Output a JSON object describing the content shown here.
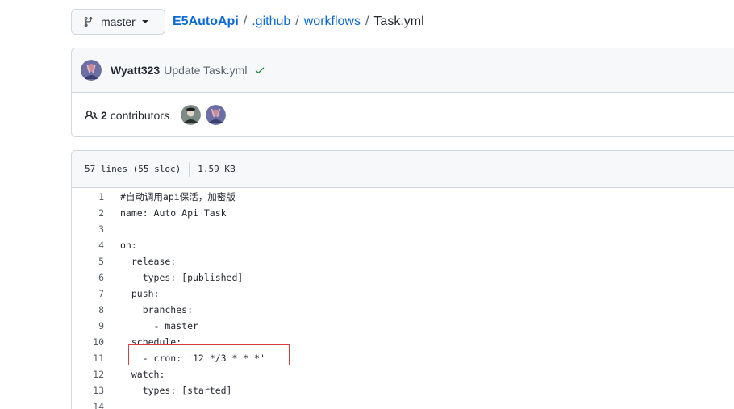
{
  "branch": {
    "label": "master"
  },
  "breadcrumb": {
    "repo": "E5AutoApi",
    "sep": "/",
    "folder1": ".github",
    "folder2": "workflows",
    "file": "Task.yml"
  },
  "commit": {
    "author": "Wyatt323",
    "message": "Update Task.yml"
  },
  "contributors": {
    "count": "2",
    "label": "contributors"
  },
  "file_info": {
    "lines": "57 lines (55 sloc)",
    "size": "1.59 KB"
  },
  "code_lines": [
    {
      "n": "1",
      "t": "#自动调用api保活，加密版"
    },
    {
      "n": "2",
      "t": "name: Auto Api Task"
    },
    {
      "n": "3",
      "t": ""
    },
    {
      "n": "4",
      "t": "on:"
    },
    {
      "n": "5",
      "t": "  release:"
    },
    {
      "n": "6",
      "t": "    types: [published]"
    },
    {
      "n": "7",
      "t": "  push:"
    },
    {
      "n": "8",
      "t": "    branches:"
    },
    {
      "n": "9",
      "t": "      - master"
    },
    {
      "n": "10",
      "t": "  schedule:"
    },
    {
      "n": "11",
      "t": "    - cron: '12 */3 * * *'"
    },
    {
      "n": "12",
      "t": "  watch:"
    },
    {
      "n": "13",
      "t": "    types: [started]"
    },
    {
      "n": "14",
      "t": ""
    }
  ],
  "colors": {
    "link": "#0969da",
    "success": "#1a7f37",
    "highlight": "#d93f3f"
  }
}
